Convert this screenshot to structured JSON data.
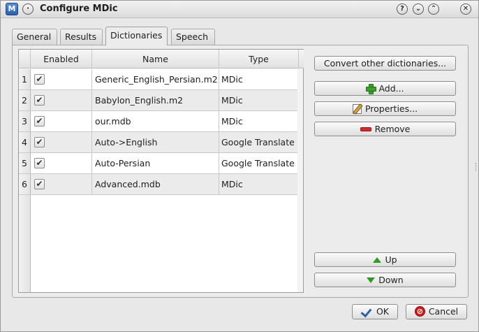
{
  "window": {
    "title": "Configure MDic",
    "app_icon_letter": "M"
  },
  "titlebar_buttons": {
    "menu": "·",
    "help": "?",
    "minimize": "⌄",
    "maximize": "⌃",
    "close": "✕"
  },
  "tabs": [
    {
      "label": "General"
    },
    {
      "label": "Results"
    },
    {
      "label": "Dictionaries"
    },
    {
      "label": "Speech"
    }
  ],
  "table": {
    "headers": {
      "enabled": "Enabled",
      "name": "Name",
      "type": "Type"
    },
    "rows": [
      {
        "num": "1",
        "checked": "✔",
        "name": "Generic_English_Persian.m2",
        "type": "MDic"
      },
      {
        "num": "2",
        "checked": "✔",
        "name": "Babylon_English.m2",
        "type": "MDic"
      },
      {
        "num": "3",
        "checked": "✔",
        "name": "our.mdb",
        "type": "MDic"
      },
      {
        "num": "4",
        "checked": "✔",
        "name": "Auto->English",
        "type": "Google Translate"
      },
      {
        "num": "5",
        "checked": "✔",
        "name": "Auto-Persian",
        "type": "Google Translate"
      },
      {
        "num": "6",
        "checked": "✔",
        "name": "Advanced.mdb",
        "type": "MDic"
      }
    ]
  },
  "buttons": {
    "convert": "Convert other dictionaries...",
    "add": "Add...",
    "properties": "Properties...",
    "remove": "Remove",
    "up": "Up",
    "down": "Down",
    "ok": "OK",
    "cancel": "Cancel"
  },
  "colors": {
    "accent_green": "#2f9a24",
    "remove_red": "#d22c2c",
    "alt_row": "#ebebeb"
  }
}
